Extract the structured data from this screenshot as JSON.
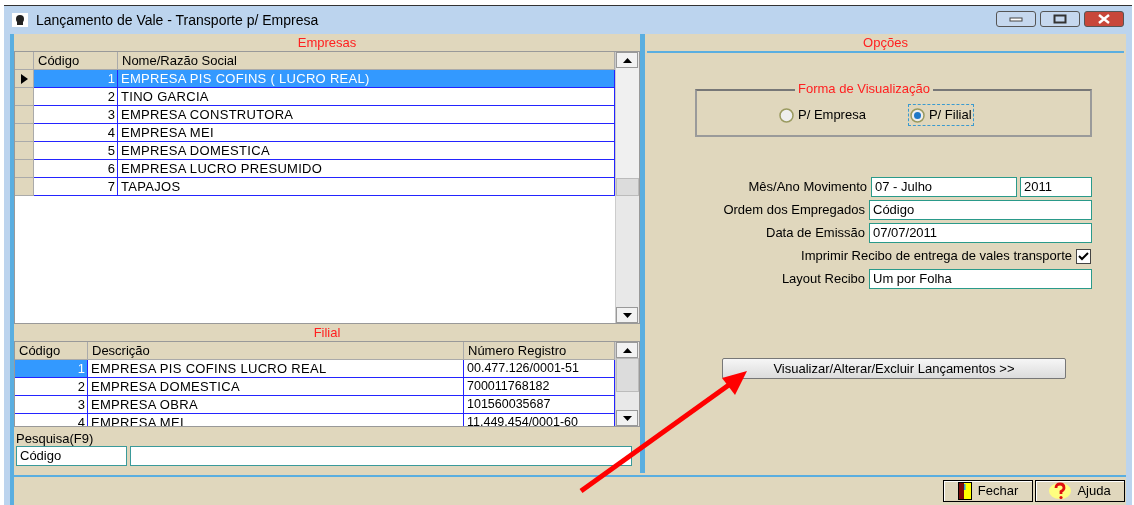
{
  "window": {
    "title": "Lançamento de Vale - Transporte p/ Empresa"
  },
  "empresas": {
    "title": "Empresas",
    "columns": [
      "Código",
      "Nome/Razão Social"
    ],
    "rows": [
      {
        "codigo": "1",
        "nome": "EMPRESA PIS COFINS ( LUCRO REAL)",
        "selected": true
      },
      {
        "codigo": "2",
        "nome": "TINO GARCIA",
        "selected": false
      },
      {
        "codigo": "3",
        "nome": "EMPRESA CONSTRUTORA",
        "selected": false
      },
      {
        "codigo": "4",
        "nome": "EMPRESA MEI",
        "selected": false
      },
      {
        "codigo": "5",
        "nome": "EMPRESA DOMESTICA",
        "selected": false
      },
      {
        "codigo": "6",
        "nome": "EMPRESA LUCRO PRESUMIDO",
        "selected": false
      },
      {
        "codigo": "7",
        "nome": "TAPAJOS",
        "selected": false
      }
    ]
  },
  "filial": {
    "title": "Filial",
    "columns": [
      "Código",
      "Descrição",
      "Número Registro"
    ],
    "rows": [
      {
        "codigo": "1",
        "descricao": "EMPRESA PIS COFINS LUCRO REAL",
        "registro": "00.477.126/0001-51",
        "selected": true
      },
      {
        "codigo": "2",
        "descricao": "EMPRESA DOMESTICA",
        "registro": "700011768182",
        "selected": false
      },
      {
        "codigo": "3",
        "descricao": "EMPRESA OBRA",
        "registro": "101560035687",
        "selected": false
      },
      {
        "codigo": "4",
        "descricao": "EMPRESA MEI",
        "registro": "11.449.454/0001-60",
        "selected": false
      }
    ]
  },
  "pesquisa": {
    "label": "Pesquisa(F9)",
    "field": "Código"
  },
  "opcoes": {
    "title": "Opções",
    "group": {
      "title": "Forma de Visualização",
      "options": [
        {
          "label": "P/ Empresa",
          "selected": false
        },
        {
          "label": "P/ Filial",
          "selected": true
        }
      ]
    },
    "fields": [
      {
        "kind": "pair",
        "label": "Mês/Ano Movimento",
        "value": "07 - Julho",
        "value2": "2011"
      },
      {
        "kind": "text",
        "label": "Ordem dos Empregados",
        "value": "Código"
      },
      {
        "kind": "text",
        "label": "Data de Emissão",
        "value": "07/07/2011"
      },
      {
        "kind": "check",
        "label": "Imprimir Recibo de entrega de vales transporte",
        "checked": true
      },
      {
        "kind": "text",
        "label": "Layout Recibo",
        "value": "Um por Folha"
      }
    ],
    "button": "Visualizar/Alterar/Excluir Lançamentos >>"
  },
  "footer_buttons": [
    {
      "kind": "close",
      "label": "Fechar"
    },
    {
      "kind": "help",
      "label": "Ajuda"
    }
  ]
}
